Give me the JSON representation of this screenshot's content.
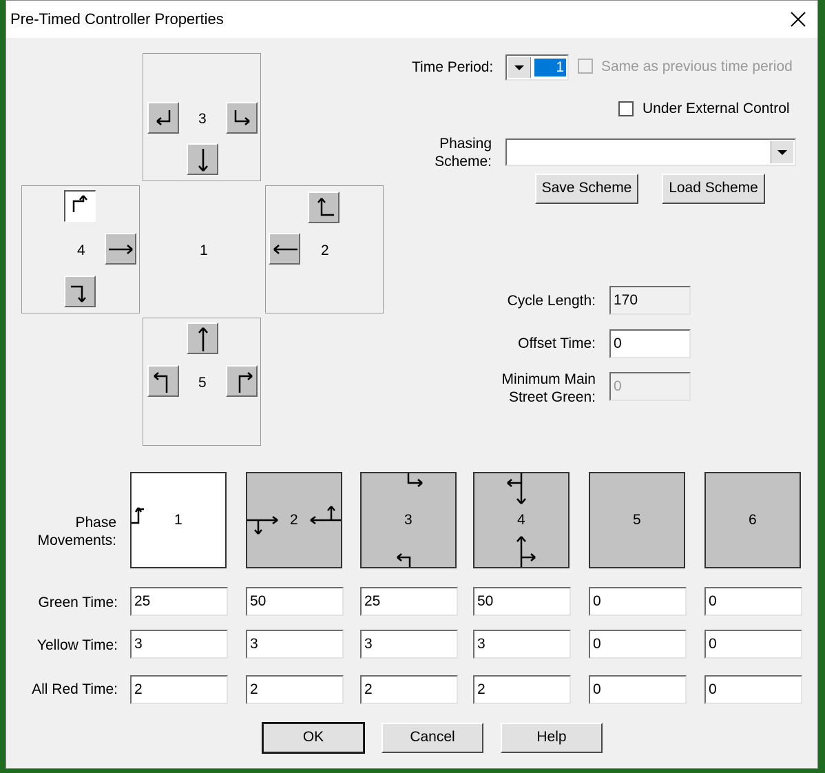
{
  "window": {
    "title": "Pre-Timed Controller Properties"
  },
  "intersection": {
    "center_number": "1",
    "north": {
      "number": "3"
    },
    "east": {
      "number": "2"
    },
    "south": {
      "number": "5"
    },
    "west": {
      "number": "4"
    }
  },
  "time_period": {
    "label": "Time Period:",
    "value": "1",
    "same_as_previous_label": "Same as previous time period"
  },
  "external_control": {
    "label": "Under External Control"
  },
  "phasing_scheme": {
    "label_line1": "Phasing",
    "label_line2": "Scheme:",
    "value": "",
    "save_label": "Save Scheme",
    "load_label": "Load Scheme"
  },
  "cycle_length": {
    "label": "Cycle Length:",
    "value": "170"
  },
  "offset_time": {
    "label": "Offset Time:",
    "value": "0"
  },
  "min_main_green": {
    "label_line1": "Minimum Main",
    "label_line2": "Street Green:",
    "value": "0"
  },
  "phases": {
    "label_line1": "Phase",
    "label_line2": "Movements:",
    "numbers": [
      "1",
      "2",
      "3",
      "4",
      "5",
      "6"
    ],
    "selected_index": 0
  },
  "timings": {
    "green_label": "Green Time:",
    "yellow_label": "Yellow Time:",
    "allred_label": "All Red Time:",
    "green": [
      "25",
      "50",
      "25",
      "50",
      "0",
      "0"
    ],
    "yellow": [
      "3",
      "3",
      "3",
      "3",
      "0",
      "0"
    ],
    "allred": [
      "2",
      "2",
      "2",
      "2",
      "0",
      "0"
    ]
  },
  "buttons": {
    "ok": "OK",
    "cancel": "Cancel",
    "help": "Help"
  }
}
